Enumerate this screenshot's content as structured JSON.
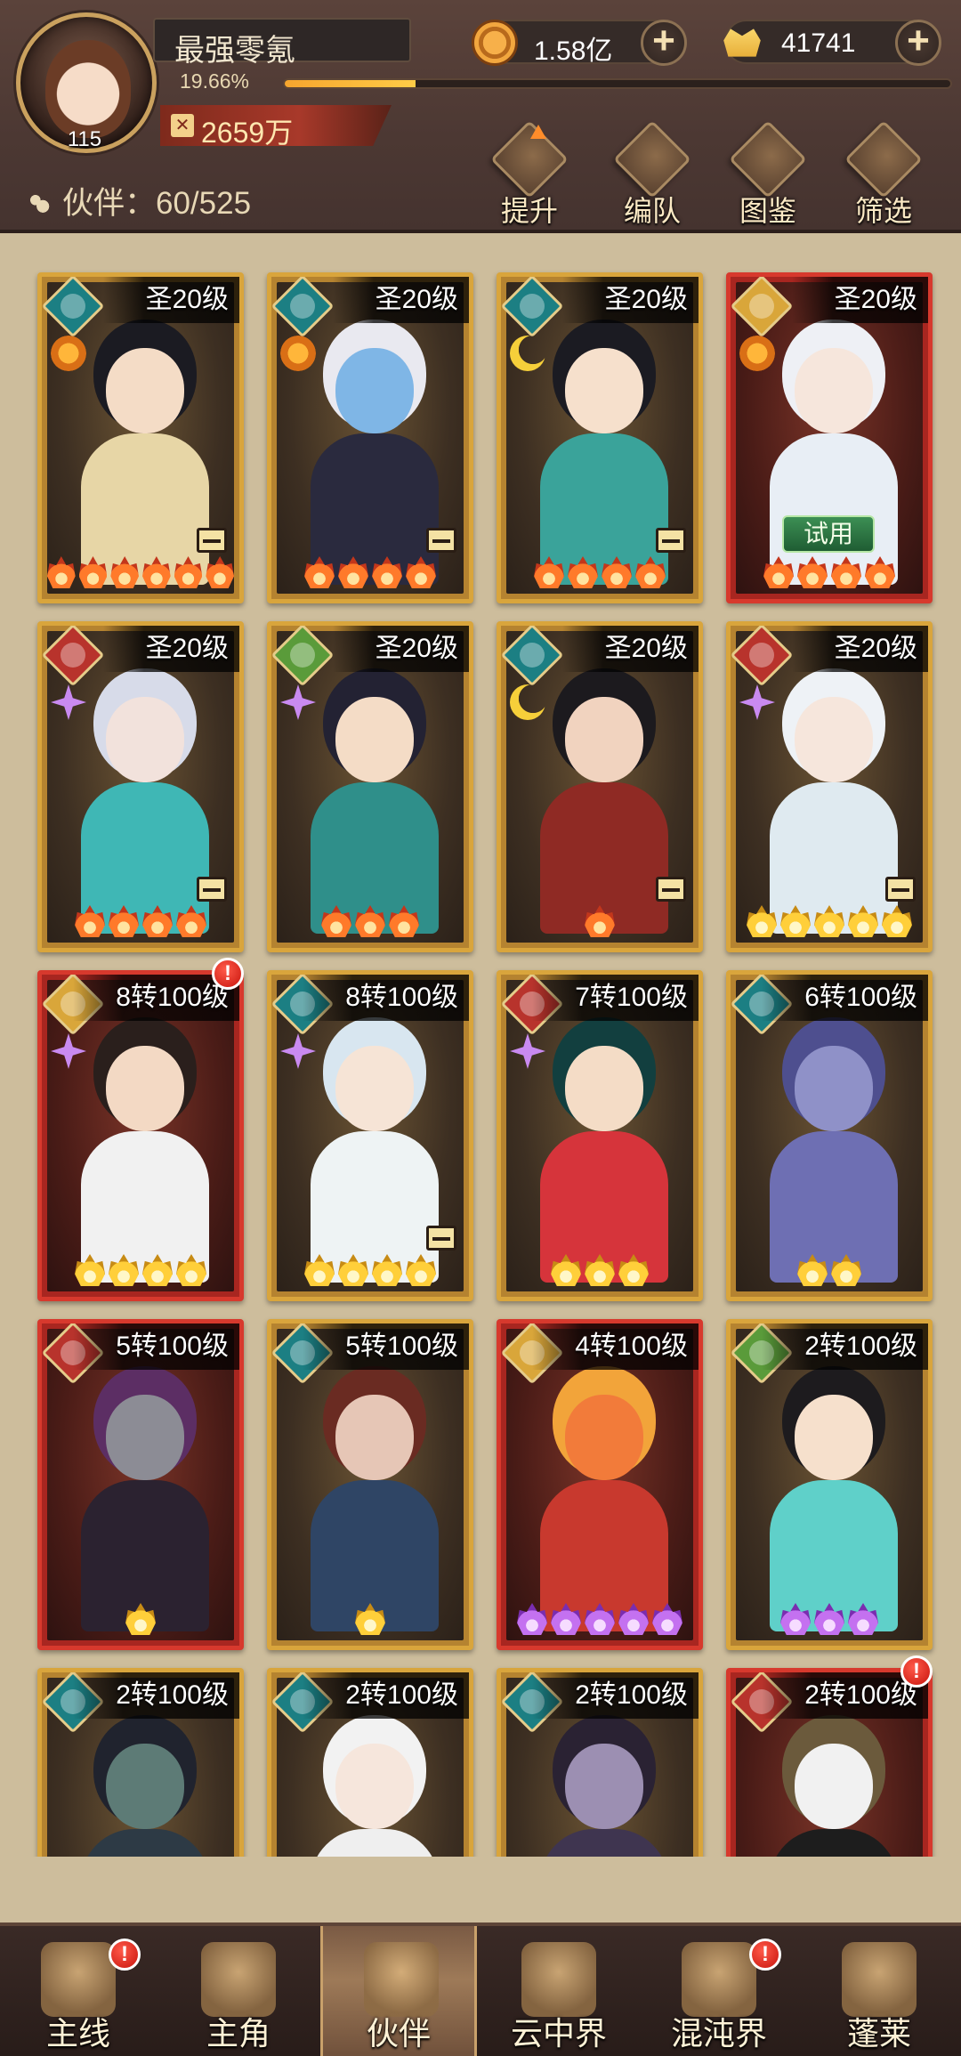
{
  "player": {
    "name": "最强零氪",
    "level": "115",
    "exp_percent": "19.66%",
    "exp_fraction": 0.1966,
    "power": "2659万"
  },
  "currencies": {
    "copper": "1.58亿",
    "gold": "41741"
  },
  "partner_count_label": "伙伴：60/525",
  "top_actions": [
    "提升",
    "编队",
    "图鉴",
    "筛选"
  ],
  "cards": [
    {
      "level": "圣20级",
      "frame": "gold",
      "faction": "teal",
      "sub": "sun",
      "flames": 6,
      "flame_color": "red",
      "equip": true,
      "trial": false,
      "alert": false,
      "hair": "#1b1b22",
      "skin": "#f4dcc6",
      "cloth": "#e7d6a6"
    },
    {
      "level": "圣20级",
      "frame": "gold",
      "faction": "teal",
      "sub": "sun",
      "flames": 4,
      "flame_color": "red",
      "equip": true,
      "trial": false,
      "alert": false,
      "hair": "#e9e9f0",
      "skin": "#7fb6e6",
      "cloth": "#2a2a3e"
    },
    {
      "level": "圣20级",
      "frame": "gold",
      "faction": "teal",
      "sub": "moon",
      "flames": 4,
      "flame_color": "red",
      "equip": true,
      "trial": false,
      "alert": false,
      "hair": "#1b1b22",
      "skin": "#f6e0cc",
      "cloth": "#3aa39a"
    },
    {
      "level": "圣20级",
      "frame": "red",
      "faction": "yellow",
      "sub": "sun",
      "flames": 4,
      "flame_color": "red",
      "equip": false,
      "trial": true,
      "alert": false,
      "hair": "#eef0f5",
      "skin": "#f6e6dc",
      "cloth": "#e8eef5"
    },
    {
      "level": "圣20级",
      "frame": "gold",
      "faction": "red",
      "sub": "star",
      "flames": 4,
      "flame_color": "red",
      "equip": true,
      "trial": false,
      "alert": false,
      "hair": "#d7dbe9",
      "skin": "#f2e2dc",
      "cloth": "#3fb7b5"
    },
    {
      "level": "圣20级",
      "frame": "gold",
      "faction": "green",
      "sub": "star",
      "flames": 3,
      "flame_color": "red",
      "equip": false,
      "trial": false,
      "alert": false,
      "hair": "#232233",
      "skin": "#f4dcc6",
      "cloth": "#2f8f8a"
    },
    {
      "level": "圣20级",
      "frame": "gold",
      "faction": "teal",
      "sub": "moon",
      "flames": 1,
      "flame_color": "red",
      "equip": true,
      "trial": false,
      "alert": false,
      "hair": "#1c1a1e",
      "skin": "#f1d3bf",
      "cloth": "#8f2a24"
    },
    {
      "level": "圣20级",
      "frame": "gold",
      "faction": "red",
      "sub": "star",
      "flames": 5,
      "flame_color": "yellow",
      "equip": true,
      "trial": false,
      "alert": false,
      "hair": "#eef2f6",
      "skin": "#f6e6dc",
      "cloth": "#dfeaf0"
    },
    {
      "level": "8转100级",
      "frame": "red",
      "faction": "yellow",
      "sub": "star",
      "flames": 4,
      "flame_color": "yellow",
      "equip": false,
      "trial": false,
      "alert": true,
      "hair": "#2a1f1c",
      "skin": "#f3d9c4",
      "cloth": "#f1f1f1"
    },
    {
      "level": "8转100级",
      "frame": "gold",
      "faction": "teal",
      "sub": "star",
      "flames": 4,
      "flame_color": "yellow",
      "equip": true,
      "trial": false,
      "alert": false,
      "hair": "#d8e6f0",
      "skin": "#f6e4d6",
      "cloth": "#eef3f4"
    },
    {
      "level": "7转100级",
      "frame": "gold",
      "faction": "red",
      "sub": "star",
      "flames": 3,
      "flame_color": "yellow",
      "equip": false,
      "trial": false,
      "alert": false,
      "hair": "#123f3f",
      "skin": "#f4dcc6",
      "cloth": "#d6343b"
    },
    {
      "level": "6转100级",
      "frame": "gold",
      "faction": "teal",
      "sub": "none",
      "flames": 2,
      "flame_color": "yellow",
      "equip": false,
      "trial": false,
      "alert": false,
      "hair": "#4e4f8f",
      "skin": "#8f91c8",
      "cloth": "#6e6fb3"
    },
    {
      "level": "5转100级",
      "frame": "red",
      "faction": "red",
      "sub": "none",
      "flames": 1,
      "flame_color": "yellow",
      "equip": false,
      "trial": false,
      "alert": false,
      "hair": "#5c2e64",
      "skin": "#8c8c95",
      "cloth": "#2b2230"
    },
    {
      "level": "5转100级",
      "frame": "gold",
      "faction": "teal",
      "sub": "none",
      "flames": 1,
      "flame_color": "yellow",
      "equip": false,
      "trial": false,
      "alert": false,
      "hair": "#6a2b22",
      "skin": "#e6c6b6",
      "cloth": "#2f4565"
    },
    {
      "level": "4转100级",
      "frame": "red",
      "faction": "yellow",
      "sub": "none",
      "flames": 5,
      "flame_color": "purple",
      "equip": false,
      "trial": false,
      "alert": false,
      "hair": "#f2a43a",
      "skin": "#f27b3a",
      "cloth": "#c8392e"
    },
    {
      "level": "2转100级",
      "frame": "gold",
      "faction": "green",
      "sub": "none",
      "flames": 3,
      "flame_color": "purple",
      "equip": false,
      "trial": false,
      "alert": false,
      "hair": "#1d1b1e",
      "skin": "#f6e0cc",
      "cloth": "#5fd0c9"
    },
    {
      "level": "2转100级",
      "frame": "gold",
      "faction": "teal",
      "sub": "none",
      "flames": 0,
      "flame_color": "yellow",
      "equip": false,
      "trial": false,
      "alert": false,
      "hair": "#20232e",
      "skin": "#5d7b76",
      "cloth": "#2d3a45"
    },
    {
      "level": "2转100级",
      "frame": "gold",
      "faction": "teal",
      "sub": "none",
      "flames": 0,
      "flame_color": "yellow",
      "equip": false,
      "trial": false,
      "alert": false,
      "hair": "#f2f2f2",
      "skin": "#f6e6dc",
      "cloth": "#efefef"
    },
    {
      "level": "2转100级",
      "frame": "gold",
      "faction": "teal",
      "sub": "none",
      "flames": 0,
      "flame_color": "yellow",
      "equip": false,
      "trial": false,
      "alert": false,
      "hair": "#2a2233",
      "skin": "#9c8fb2",
      "cloth": "#3f3550"
    },
    {
      "level": "2转100级",
      "frame": "red",
      "faction": "red",
      "sub": "none",
      "flames": 0,
      "flame_color": "yellow",
      "equip": false,
      "trial": false,
      "alert": true,
      "hair": "#6b5a3c",
      "skin": "#f1f1f1",
      "cloth": "#1d1d1d"
    }
  ],
  "trial_label": "试用",
  "alert_mark": "!",
  "bottom_nav": [
    {
      "label": "主线",
      "alert": true,
      "active": false
    },
    {
      "label": "主角",
      "alert": false,
      "active": false
    },
    {
      "label": "伙伴",
      "alert": false,
      "active": true
    },
    {
      "label": "云中界",
      "alert": false,
      "active": false
    },
    {
      "label": "混沌界",
      "alert": true,
      "active": false
    },
    {
      "label": "蓬莱",
      "alert": false,
      "active": false
    }
  ],
  "colors": {
    "faction_teal": "#1c7f83",
    "faction_red": "#b8332c",
    "faction_yellow": "#d9a63a",
    "faction_green": "#5a9b3a"
  }
}
